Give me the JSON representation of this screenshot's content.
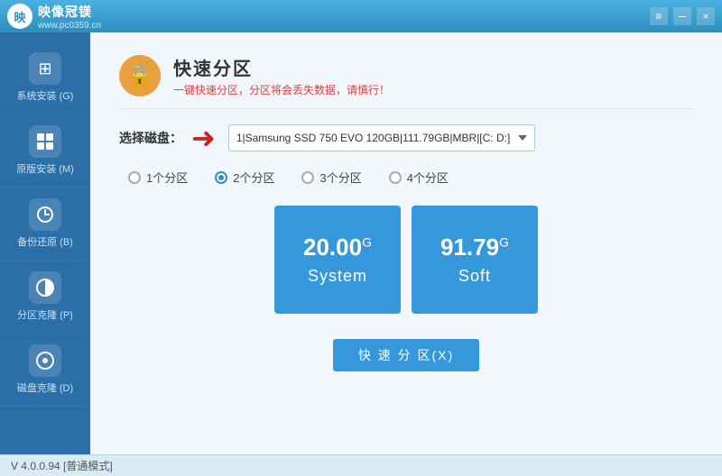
{
  "titleBar": {
    "logoText": "映像冠镁",
    "logoSub": "www.pc0359.cn",
    "controls": {
      "menu": "≡",
      "minimize": "－",
      "close": "×"
    }
  },
  "sidebar": {
    "items": [
      {
        "id": "system-install",
        "label": "系统安装 (G)",
        "icon": "⊞"
      },
      {
        "id": "original-install",
        "label": "原版安装 (M)",
        "icon": "⊟"
      },
      {
        "id": "backup-restore",
        "label": "备份还原 (B)",
        "icon": "↺"
      },
      {
        "id": "partition-clone",
        "label": "分区克隆 (P)",
        "icon": "◑"
      },
      {
        "id": "disk-clone",
        "label": "磁盘克隆 (D)",
        "icon": "⊙"
      }
    ]
  },
  "page": {
    "headerIcon": "🔒",
    "title": "快速分区",
    "subtitle": "一键快速分区，分区将会丢失数据，请慎行！"
  },
  "diskSelect": {
    "label": "选择磁盘：",
    "value": "1|Samsung SSD 750 EVO 120GB|111.79GB|MBR|[C:   D:]",
    "options": [
      "1|Samsung SSD 750 EVO 120GB|111.79GB|MBR|[C:   D:]"
    ]
  },
  "partitionOptions": {
    "items": [
      {
        "id": "1",
        "label": "1个分区",
        "checked": false
      },
      {
        "id": "2",
        "label": "2个分区",
        "checked": true
      },
      {
        "id": "3",
        "label": "3个分区",
        "checked": false
      },
      {
        "id": "4",
        "label": "4个分区",
        "checked": false
      }
    ]
  },
  "partitionTiles": [
    {
      "id": "system",
      "size": "20.00",
      "unit": "G",
      "name": "System"
    },
    {
      "id": "soft",
      "size": "91.79",
      "unit": "G",
      "name": "Soft"
    }
  ],
  "actionButton": {
    "label": "快 速 分 区(X)"
  },
  "statusBar": {
    "text": "V 4.0.0.94 [普通模式]"
  }
}
